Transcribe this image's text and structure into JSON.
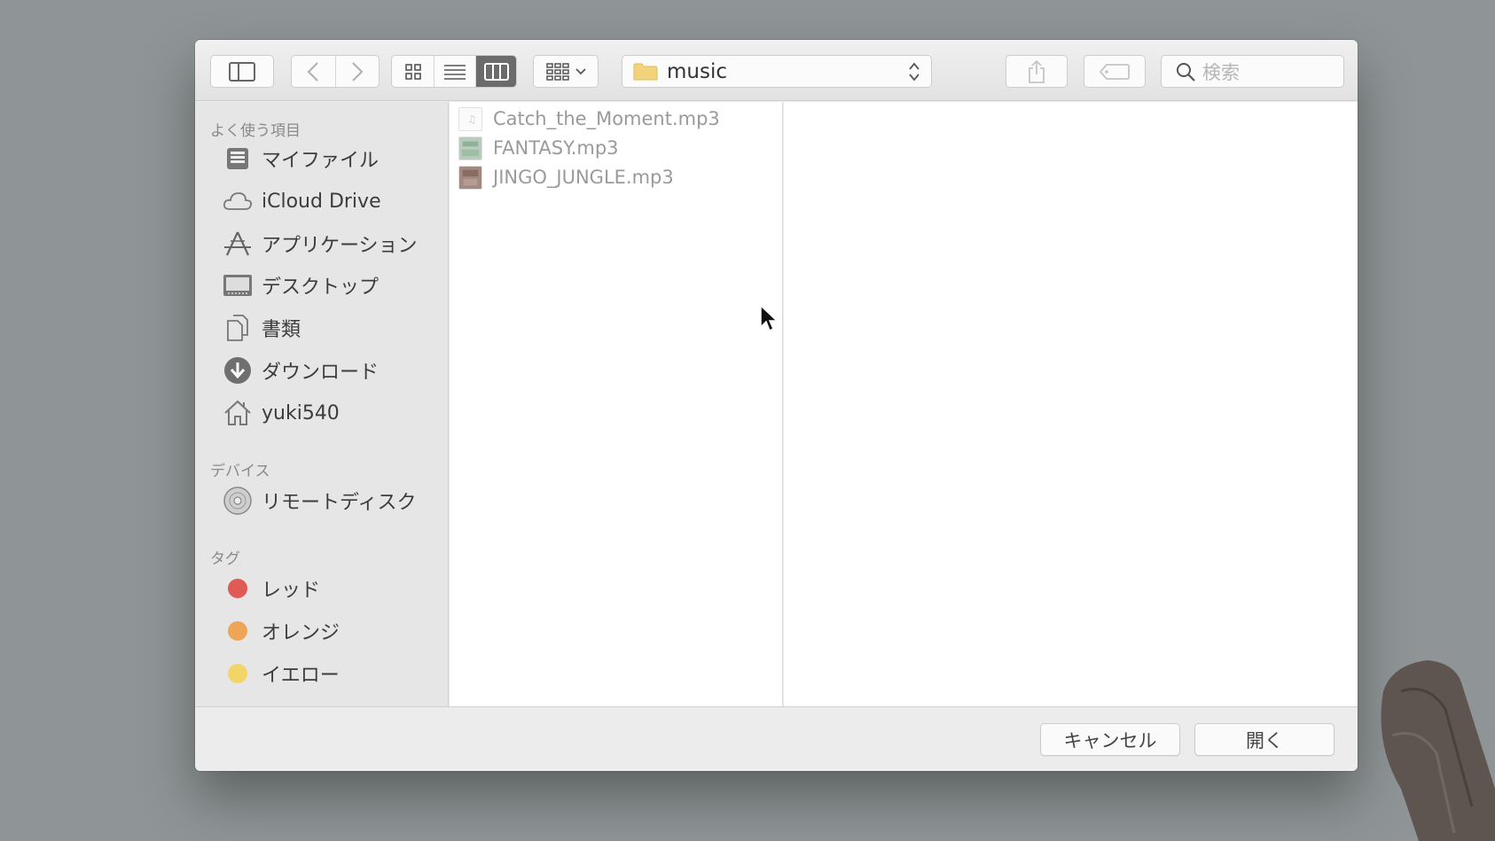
{
  "toolbar": {
    "path_folder": "music",
    "search_placeholder": "検索"
  },
  "sidebar": {
    "favorites_header": "よく使う項目",
    "favorites": [
      {
        "label": "マイファイル",
        "icon": "all-files-icon"
      },
      {
        "label": "iCloud Drive",
        "icon": "cloud-icon"
      },
      {
        "label": "アプリケーション",
        "icon": "applications-icon"
      },
      {
        "label": "デスクトップ",
        "icon": "desktop-icon"
      },
      {
        "label": "書類",
        "icon": "documents-icon"
      },
      {
        "label": "ダウンロード",
        "icon": "downloads-icon"
      },
      {
        "label": "yuki540",
        "icon": "home-icon"
      }
    ],
    "devices_header": "デバイス",
    "devices": [
      {
        "label": "リモートディスク",
        "icon": "disc-icon"
      }
    ],
    "tags_header": "タグ",
    "tags": [
      {
        "label": "レッド",
        "color": "#e05a56"
      },
      {
        "label": "オレンジ",
        "color": "#eea557"
      },
      {
        "label": "イエロー",
        "color": "#f3d567"
      }
    ]
  },
  "files": [
    {
      "name": "Catch_the_Moment.mp3",
      "thumb": "music-file-icon"
    },
    {
      "name": "FANTASY.mp3",
      "thumb": "album-art-green"
    },
    {
      "name": "JINGO_JUNGLE.mp3",
      "thumb": "album-art-brown"
    }
  ],
  "buttons": {
    "cancel": "キャンセル",
    "open": "開く"
  }
}
